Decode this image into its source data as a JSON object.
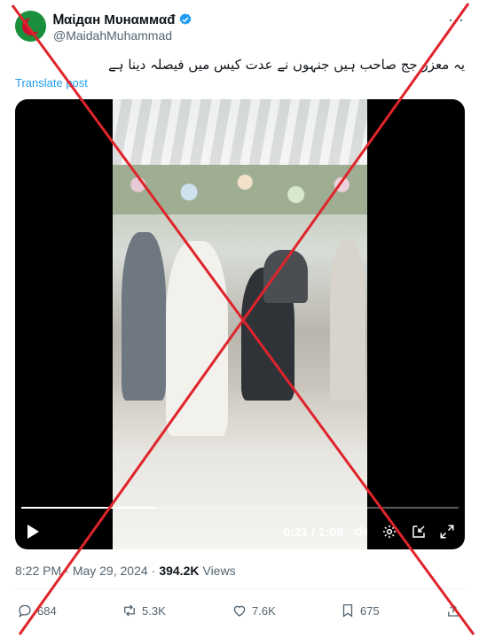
{
  "author": {
    "display_name": "Ꮇαiдαн Мυнαммαđ",
    "handle": "@MaidahMuhammad",
    "avatar_icon": "flag-avatar-icon",
    "verified_icon": "verified-badge-icon"
  },
  "tweet": {
    "text": "یہ معزز جج صاحب ہیں جنہوں نے عدت کیس میں فیصلہ دینا ہے",
    "translate_label": "Translate post"
  },
  "video": {
    "current_time": "0:21",
    "duration": "1:08",
    "time_label": "0:21 / 1:08",
    "progress_fraction": 0.309
  },
  "meta": {
    "time": "8:22 PM",
    "separator": "·",
    "date": "May 29, 2024",
    "views_count": "394.2K",
    "views_label": "Views"
  },
  "actions": {
    "replies": "684",
    "reposts": "5.3K",
    "likes": "7.6K",
    "bookmarks": "675"
  },
  "colors": {
    "accent": "#1d9bf0",
    "cross": "#e0242b",
    "muted": "#536471"
  }
}
